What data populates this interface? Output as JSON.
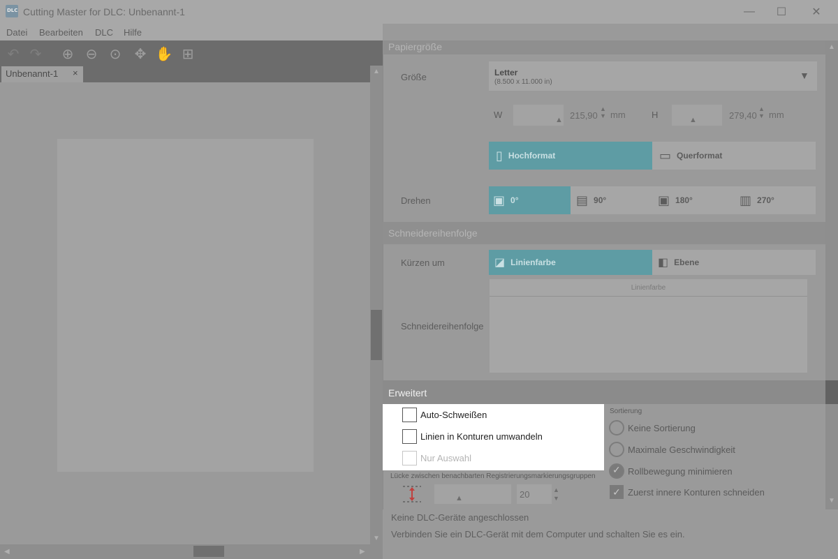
{
  "window": {
    "title": "Cutting Master for DLC: Unbenannt-1",
    "icon_text": "DLC",
    "minimize": "—",
    "maximize": "☐",
    "close": "✕"
  },
  "menu": [
    "Datei",
    "Bearbeiten",
    "DLC",
    "Hilfe"
  ],
  "toolbar": {
    "undo": "↶",
    "redo": "↷",
    "zoom_in": "⊕",
    "zoom_out": "⊖",
    "zoom_fit": "⊙",
    "move": "✥",
    "pan": "✋",
    "add": "⊞"
  },
  "document": {
    "tab_label": "Unbenannt-1",
    "tab_close": "×"
  },
  "paper_size": {
    "header": "Papiergröße",
    "size_label": "Größe",
    "size_name": "Letter",
    "size_dims": "(8.500 x 11.000 in)",
    "w_label": "W",
    "w_value": "215,90",
    "w_unit": "mm",
    "h_label": "H",
    "h_value": "279,40",
    "h_unit": "mm",
    "portrait": "Hochformat",
    "landscape": "Querformat",
    "rotate_label": "Drehen",
    "rotations": [
      "0°",
      "90°",
      "180°",
      "270°"
    ]
  },
  "cut_order": {
    "header": "Schneidereihenfolge",
    "sort_by_label": "Kürzen um",
    "by_line_color": "Linienfarbe",
    "by_layer": "Ebene",
    "table_header": "Linienfarbe",
    "order_label": "Schneidereihenfolge"
  },
  "advanced": {
    "header": "Erweitert",
    "auto_weld": "Auto-Schweißen",
    "lines_to_contours": "Linien in Konturen umwandeln",
    "selection_only": "Nur Auswahl",
    "gap_label": "Lücke zwischen benachbarten Registrierungsmarkierungsgruppen",
    "gap_value": "20",
    "sorting": {
      "title": "Sortierung",
      "options": [
        "Keine Sortierung",
        "Maximale Geschwindigkeit",
        "Rollbewegung minimieren"
      ],
      "selected": "Rollbewegung minimieren",
      "inner_first": "Zuerst innere Konturen schneiden"
    }
  },
  "status": {
    "line1": "Keine DLC-Geräte angeschlossen",
    "line2": "Verbinden Sie ein DLC-Gerät mit dem Computer und schalten Sie es ein."
  }
}
